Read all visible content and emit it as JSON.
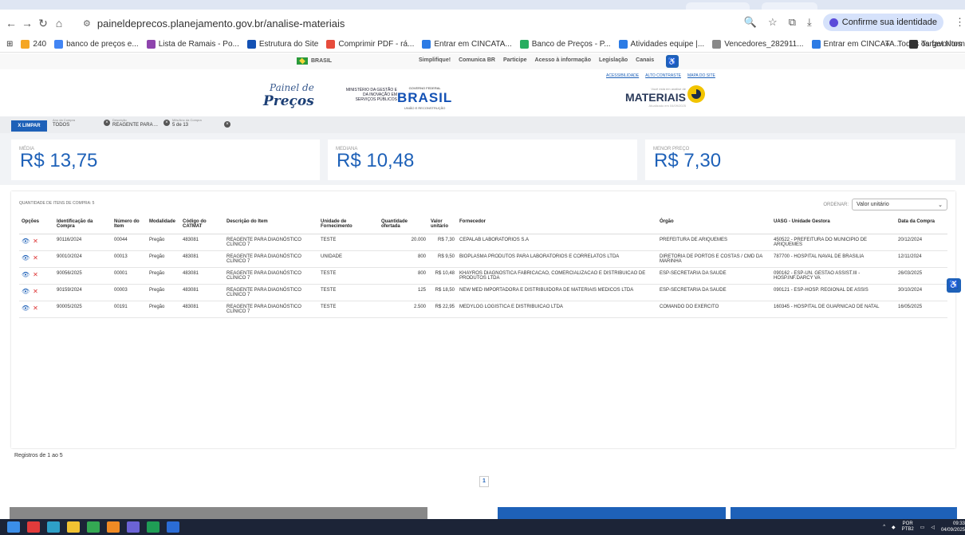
{
  "browser": {
    "url": "paineldeprecos.planejamento.gov.br/analise-materiais",
    "confirm_label": "Confirme sua identidade",
    "bookmarks": [
      "240",
      "banco de preços e...",
      "Lista de Ramais - Po...",
      "Estrutura do Site",
      "Comprimir PDF - rá...",
      "Entrar em CINCATA...",
      "Banco de Preços - P...",
      "Atividades equipe |...",
      "Vencedores_282911...",
      "Entrar em CINCATA...",
      "Target Normas: Bus..."
    ],
    "bookmarks_more": "»",
    "all_favorites": "Todos os favoritos"
  },
  "govbar": {
    "brasil": "BRASIL",
    "links": [
      "Simplifique!",
      "Comunica BR",
      "Participe",
      "Acesso à informação",
      "Legislação",
      "Canais"
    ]
  },
  "header": {
    "logo_line1": "Painel de",
    "logo_line2": "Preços",
    "ministry": "MINISTÉRIO DA GESTÃO E DA INOVAÇÃO EM SERVIÇOS PÚBLICOS",
    "gov_top": "GOVERNO FEDERAL",
    "gov_word": "BRASIL",
    "gov_sub": "UNIÃO E RECONSTRUÇÃO",
    "top_links": [
      "ACESSIBILIDADE",
      "ALTO CONTRASTE",
      "MAPA DO SITE"
    ],
    "materials_small": "Você está em análise de",
    "materials": "MATERIAIS",
    "updated": "Atualizado em 04/09/2025"
  },
  "filters": {
    "clear": "X LIMPAR",
    "chips": [
      {
        "label": "Ano da Compra",
        "value": "TODOS",
        "removable": false
      },
      {
        "label": "Descrição",
        "value": "REAGENTE PARA ...",
        "removable": true
      },
      {
        "label": "Mês/Ano da Compra",
        "value": "5 de 13",
        "removable": true
      }
    ]
  },
  "stats": {
    "media_label": "MÉDIA",
    "media": "R$ 13,75",
    "mediana_label": "MEDIANA",
    "mediana": "R$ 10,48",
    "menor_label": "MENOR PREÇO",
    "menor": "R$ 7,30"
  },
  "table": {
    "count_label": "QUANTIDADE DE ITENS DE COMPRA: 5",
    "order_label": "ORDENAR:",
    "order_value": "Valor unitário",
    "headers": [
      "Opções",
      "Identificação da Compra",
      "Número do Item",
      "Modalidade",
      "Código do CATMAT",
      "Descrição do Item",
      "Unidade de Fornecimento",
      "Quantidade ofertada",
      "Valor unitário",
      "Fornecedor",
      "Órgão",
      "UASG - Unidade Gestora",
      "Data da Compra"
    ],
    "rows": [
      [
        "90116/2024",
        "00044",
        "Pregão",
        "483081",
        "REAGENTE PARA DIAGNÓSTICO CLÍNICO 7",
        "TESTE",
        "20.000",
        "R$ 7,30",
        "CEPALAB LABORATORIOS S.A",
        "PREFEITURA DE ARIQUEMES",
        "450522 - PREFEITURA DO MUNICIPIO DE ARIQUEMES",
        "20/12/2024"
      ],
      [
        "90010/2024",
        "00013",
        "Pregão",
        "483081",
        "REAGENTE PARA DIAGNÓSTICO CLÍNICO 7",
        "UNIDADE",
        "800",
        "R$ 9,50",
        "BIOPLASMA PRODUTOS PARA LABORATORIOS E CORRELATOS LTDA",
        "DIRETORIA DE PORTOS E COSTAS / CMD DA MARINHA",
        "787700 - HOSPITAL NAVAL DE BRASILIA",
        "12/11/2024"
      ],
      [
        "90056/2025",
        "00001",
        "Pregão",
        "483081",
        "REAGENTE PARA DIAGNÓSTICO CLÍNICO 7",
        "TESTE",
        "800",
        "R$ 10,48",
        "KHAYROS DIAGNOSTICA FABRICACAO, COMERCIALIZACAO E DISTRIBUICAO DE PRODUTOS LTDA",
        "ESP-SECRETARIA DA SAUDE",
        "090162 - ESP-UN. GESTAO ASSIST.III - HOSP.INF.DARCY VA",
        "26/03/2025"
      ],
      [
        "90159/2024",
        "00003",
        "Pregão",
        "483081",
        "REAGENTE PARA DIAGNÓSTICO CLÍNICO 7",
        "TESTE",
        "125",
        "R$ 18,50",
        "NEW MED IMPORTADORA E DISTRIBUIDORA DE MATERIAIS MEDICOS LTDA",
        "ESP-SECRETARIA DA SAUDE",
        "090121 - ESP-HOSP. REGIONAL DE ASSIS",
        "30/10/2024"
      ],
      [
        "90005/2025",
        "00191",
        "Pregão",
        "483081",
        "REAGENTE PARA DIAGNÓSTICO CLÍNICO 7",
        "TESTE",
        "2.500",
        "R$ 22,95",
        "MEDYLOG LOGISTICA E DISTRIBUICAO LTDA",
        "COMANDO DO EXERCITO",
        "160345 - HOSPITAL DE GUARNICAO DE NATAL",
        "16/05/2025"
      ]
    ],
    "records": "Registros de 1 ao 5",
    "page": "1"
  },
  "taskbar": {
    "lang1": "POR",
    "lang2": "PTB2",
    "time": "09:33",
    "date": "04/09/2025"
  },
  "colors": {
    "primary": "#1e61b8",
    "danger": "#dd3333"
  }
}
